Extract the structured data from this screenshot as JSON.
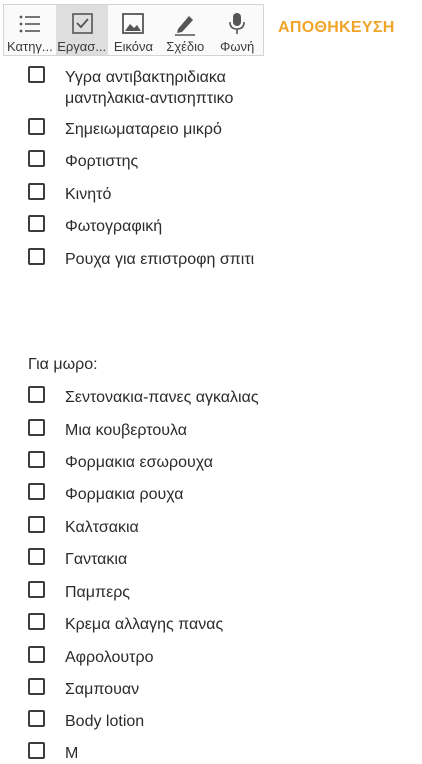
{
  "toolbar": {
    "tools": [
      {
        "label": "Κατηγ...",
        "icon": "list-icon"
      },
      {
        "label": "Εργασ...",
        "icon": "checkbox-icon"
      },
      {
        "label": "Εικόνα",
        "icon": "image-icon"
      },
      {
        "label": "Σχέδιο",
        "icon": "pencil-icon"
      },
      {
        "label": "Φωνή",
        "icon": "microphone-icon"
      }
    ],
    "active_index": 1
  },
  "save_label": "ΑΠΟΘΗΚΕΥΣΗ",
  "colors": {
    "accent": "#f0a52a",
    "text": "#2b2b2b",
    "active_tool_bg": "#dedede"
  },
  "list_top": [
    {
      "line1": "Υγρα αντιβακτηριδιακα",
      "line2": "μαντηλακια-αντισηπτικο"
    },
    {
      "line1": "Σημειωματαρειο μικρό"
    },
    {
      "line1": "Φορτιστης"
    },
    {
      "line1": "Κινητό"
    },
    {
      "line1": "Φωτογραφική"
    },
    {
      "line1": "Ρουχα για επιστροφη σπιτι"
    }
  ],
  "section_heading": "Για μωρο:",
  "list_baby": [
    "Σεντονακια-πανες αγκαλιας",
    "Μια κουβερτουλα",
    "Φορμακια εσωρουχα",
    "Φορμακια ρουχα",
    "Καλτσακια",
    "Γαντακια",
    "Παμπερς",
    "Κρεμα αλλαγης πανας",
    "Αφρολουτρο",
    "Σαμπουαν",
    "Body lotion",
    "Μ"
  ]
}
